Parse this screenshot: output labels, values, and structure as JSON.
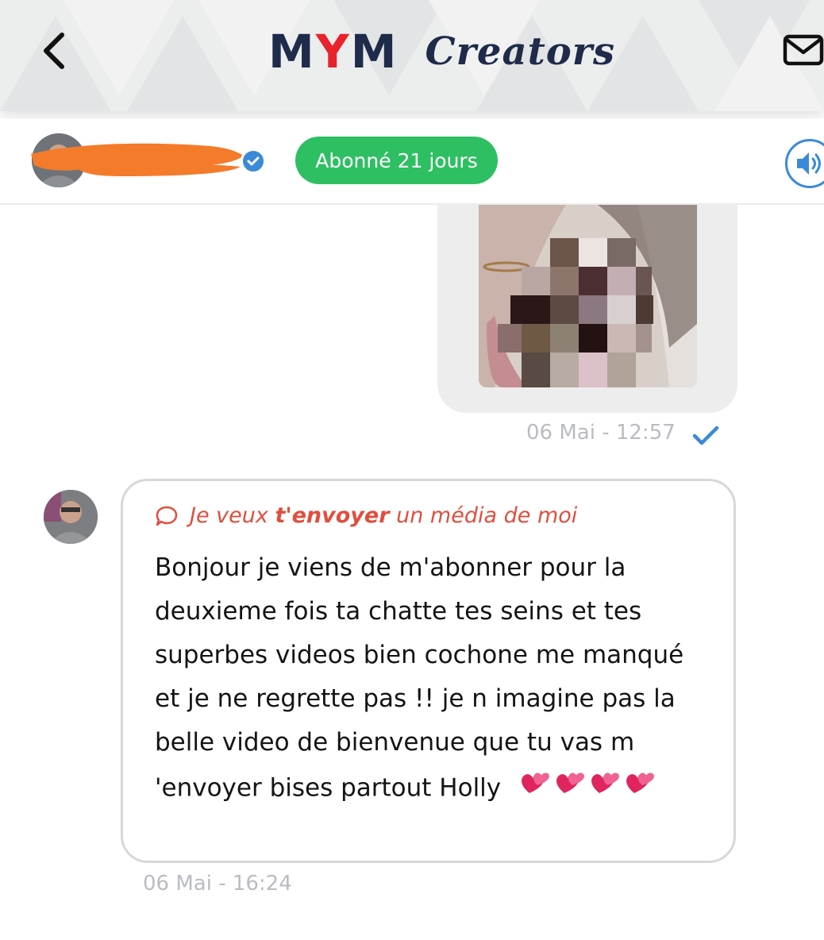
{
  "header": {
    "brand": "MYM",
    "brand_sub": "Creators"
  },
  "profile": {
    "subscription_badge": "Abonné 21 jours"
  },
  "colors": {
    "brand_navy": "#1e2b4a",
    "brand_red": "#e8232b",
    "badge_green": "#2fbf63",
    "accent_blue": "#3b8ad8",
    "request_red": "#e04e3e"
  },
  "icons": [
    "back-arrow-icon",
    "mail-icon",
    "verified-icon",
    "speaker-icon",
    "check-icon",
    "chat-bubble-icon",
    "heart-icon"
  ],
  "sent_message": {
    "timestamp": "06 Mai - 12:57"
  },
  "received_message": {
    "request_prefix": "Je veux",
    "request_bold": "t'envoyer",
    "request_suffix": "un média de moi",
    "text": "Bonjour je viens de m'abonner pour la deuxieme fois ta chatte tes seins et tes superbes videos bien cochone me manqué et je ne regrette pas !! je n imagine pas la belle video de bienvenue que tu vas m 'envoyer bises partout Holly",
    "timestamp": "06 Mai - 16:24"
  }
}
